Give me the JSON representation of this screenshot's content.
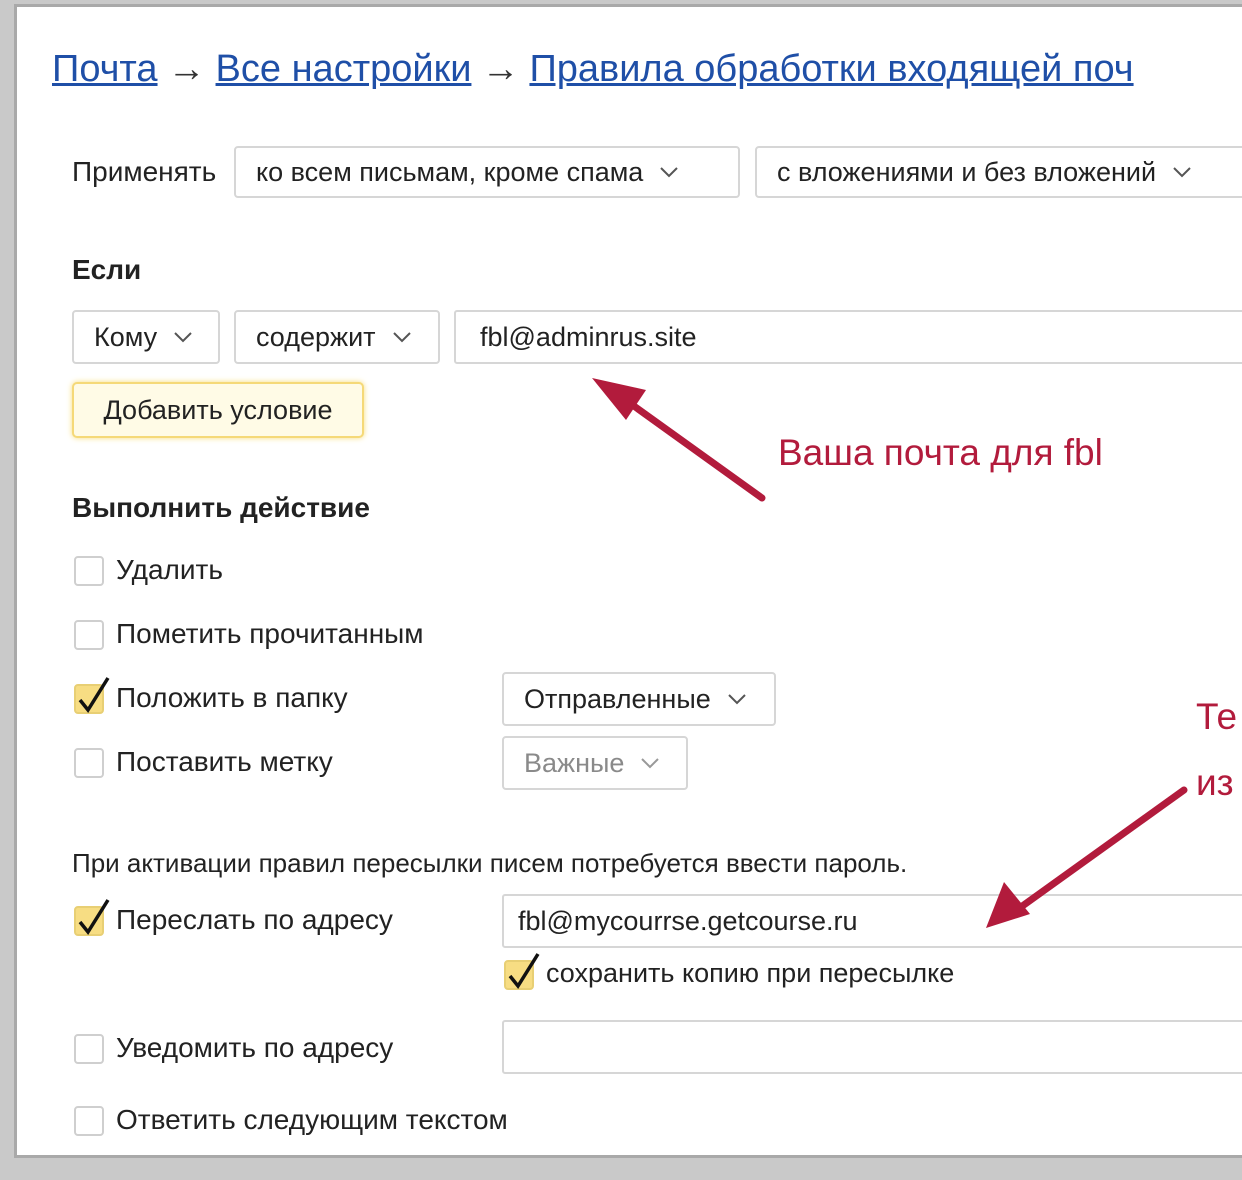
{
  "breadcrumb": {
    "items": [
      "Почта",
      "Все настройки",
      "Правила обработки входящей поч"
    ],
    "separator": "→"
  },
  "apply": {
    "label": "Применять",
    "scope_select": "ко всем письмам, кроме спама",
    "attach_select": "с вложениями и без вложений"
  },
  "if_section": {
    "heading": "Если",
    "field_select": "Кому",
    "op_select": "содержит",
    "value": "fbl@adminrus.site",
    "add_condition_label": "Добавить условие"
  },
  "actions": {
    "heading": "Выполнить действие",
    "delete_label": "Удалить",
    "mark_read_label": "Пометить прочитанным",
    "move_folder_label": "Положить в папку",
    "folder_select": "Отправленные",
    "set_label_label": "Поставить метку",
    "label_select": "Важные",
    "forward_notice": "При активации правил пересылки писем потребуется ввести пароль.",
    "forward_label": "Переслать по адресу",
    "forward_value": "fbl@mycourrse.getcourse.ru",
    "save_copy_label": "сохранить копию при пересылке",
    "notify_label": "Уведомить по адресу",
    "notify_value": "",
    "reply_label": "Ответить следующим текстом",
    "checked": {
      "delete": false,
      "mark_read": false,
      "move_folder": true,
      "set_label": false,
      "forward": true,
      "save_copy": true,
      "notify": false,
      "reply": false
    }
  },
  "annotations": {
    "note1": "Ваша почта для fbl",
    "note2_line1": "Те",
    "note2_line2": "из",
    "color": "#b21b3c"
  },
  "colors": {
    "link": "#1f4fa7",
    "checkbox_on": "#f7dd83",
    "add_button_glow": "#f7dd7a"
  }
}
